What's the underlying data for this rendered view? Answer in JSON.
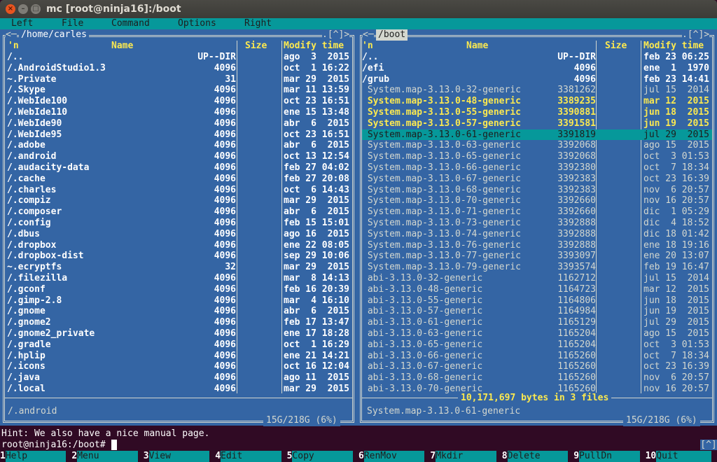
{
  "window": {
    "title": "mc [root@ninja16]:/boot",
    "buttons": [
      "close",
      "minimize",
      "maximize"
    ]
  },
  "menubar": [
    "Left",
    "File",
    "Command",
    "Options",
    "Right"
  ],
  "left_panel": {
    "path": "/home/carles",
    "nav_left": "<─",
    "corner": ".[^]>",
    "columns": {
      "sort": "'n",
      "name": "Name",
      "size": "Size",
      "mtime": "Modify time"
    },
    "rows": [
      {
        "name": "/..",
        "size": "UP--DIR",
        "mtime": "ago  3  2015",
        "type": "dir"
      },
      {
        "name": "/.AndroidStudio1.3",
        "size": "4096",
        "mtime": "oct  1 16:22",
        "type": "dir"
      },
      {
        "name": "~.Private",
        "size": "31",
        "mtime": "mar 29  2015",
        "type": "dir"
      },
      {
        "name": "/.Skype",
        "size": "4096",
        "mtime": "mar 11 13:59",
        "type": "dir"
      },
      {
        "name": "/.WebIde100",
        "size": "4096",
        "mtime": "oct 23 16:51",
        "type": "dir"
      },
      {
        "name": "/.WebIde110",
        "size": "4096",
        "mtime": "ene 15 13:48",
        "type": "dir"
      },
      {
        "name": "/.WebIde90",
        "size": "4096",
        "mtime": "abr  6  2015",
        "type": "dir"
      },
      {
        "name": "/.WebIde95",
        "size": "4096",
        "mtime": "oct 23 16:51",
        "type": "dir"
      },
      {
        "name": "/.adobe",
        "size": "4096",
        "mtime": "abr  6  2015",
        "type": "dir"
      },
      {
        "name": "/.android",
        "size": "4096",
        "mtime": "oct 13 12:54",
        "type": "dir"
      },
      {
        "name": "/.audacity-data",
        "size": "4096",
        "mtime": "feb 27 04:02",
        "type": "dir"
      },
      {
        "name": "/.cache",
        "size": "4096",
        "mtime": "feb 27 20:08",
        "type": "dir"
      },
      {
        "name": "/.charles",
        "size": "4096",
        "mtime": "oct  6 14:43",
        "type": "dir"
      },
      {
        "name": "/.compiz",
        "size": "4096",
        "mtime": "mar 29  2015",
        "type": "dir"
      },
      {
        "name": "/.composer",
        "size": "4096",
        "mtime": "abr  6  2015",
        "type": "dir"
      },
      {
        "name": "/.config",
        "size": "4096",
        "mtime": "feb 15 15:01",
        "type": "dir"
      },
      {
        "name": "/.dbus",
        "size": "4096",
        "mtime": "ago 16  2015",
        "type": "dir"
      },
      {
        "name": "/.dropbox",
        "size": "4096",
        "mtime": "ene 22 08:05",
        "type": "dir"
      },
      {
        "name": "/.dropbox-dist",
        "size": "4096",
        "mtime": "sep 29 10:06",
        "type": "dir"
      },
      {
        "name": "~.ecryptfs",
        "size": "32",
        "mtime": "mar 29  2015",
        "type": "dir"
      },
      {
        "name": "/.filezilla",
        "size": "4096",
        "mtime": "mar  8 14:13",
        "type": "dir"
      },
      {
        "name": "/.gconf",
        "size": "4096",
        "mtime": "feb 16 20:39",
        "type": "dir"
      },
      {
        "name": "/.gimp-2.8",
        "size": "4096",
        "mtime": "mar  4 16:10",
        "type": "dir"
      },
      {
        "name": "/.gnome",
        "size": "4096",
        "mtime": "abr  6  2015",
        "type": "dir"
      },
      {
        "name": "/.gnome2",
        "size": "4096",
        "mtime": "feb 17 13:47",
        "type": "dir"
      },
      {
        "name": "/.gnome2_private",
        "size": "4096",
        "mtime": "ene 17 18:28",
        "type": "dir"
      },
      {
        "name": "/.gradle",
        "size": "4096",
        "mtime": "oct  1 16:29",
        "type": "dir"
      },
      {
        "name": "/.hplip",
        "size": "4096",
        "mtime": "ene 21 14:21",
        "type": "dir"
      },
      {
        "name": "/.icons",
        "size": "4096",
        "mtime": "oct 16 12:04",
        "type": "dir"
      },
      {
        "name": "/.java",
        "size": "4096",
        "mtime": "ago 11  2015",
        "type": "dir"
      },
      {
        "name": "/.local",
        "size": "4096",
        "mtime": "mar 29  2015",
        "type": "dir"
      }
    ],
    "mini_status": "/.android",
    "disk_info": "15G/218G (6%)"
  },
  "right_panel": {
    "path": "/boot",
    "nav_left": "<─",
    "corner": ".[^]>",
    "columns": {
      "sort": "'n",
      "name": "Name",
      "size": "Size",
      "mtime": "Modify time"
    },
    "rows": [
      {
        "name": "/..",
        "size": "UP--DIR",
        "mtime": "feb 23 06:25",
        "type": "dir"
      },
      {
        "name": "/efi",
        "size": "4096",
        "mtime": "ene  1  1970",
        "type": "dir"
      },
      {
        "name": "/grub",
        "size": "4096",
        "mtime": "feb 23 14:41",
        "type": "dir"
      },
      {
        "name": " System.map-3.13.0-32-generic",
        "size": "3381262",
        "mtime": "jul 15  2014",
        "type": "file"
      },
      {
        "name": " System.map-3.13.0-48-generic",
        "size": "3389235",
        "mtime": "mar 12  2015",
        "type": "marked"
      },
      {
        "name": " System.map-3.13.0-55-generic",
        "size": "3390881",
        "mtime": "jun 18  2015",
        "type": "marked"
      },
      {
        "name": " System.map-3.13.0-57-generic",
        "size": "3391581",
        "mtime": "jun 19  2015",
        "type": "marked"
      },
      {
        "name": " System.map-3.13.0-61-generic",
        "size": "3391819",
        "mtime": "jul 29  2015",
        "type": "selected"
      },
      {
        "name": " System.map-3.13.0-63-generic",
        "size": "3392068",
        "mtime": "ago 15  2015",
        "type": "file"
      },
      {
        "name": " System.map-3.13.0-65-generic",
        "size": "3392068",
        "mtime": "oct  3 01:53",
        "type": "file"
      },
      {
        "name": " System.map-3.13.0-66-generic",
        "size": "3392380",
        "mtime": "oct  7 18:34",
        "type": "file"
      },
      {
        "name": " System.map-3.13.0-67-generic",
        "size": "3392383",
        "mtime": "oct 23 16:39",
        "type": "file"
      },
      {
        "name": " System.map-3.13.0-68-generic",
        "size": "3392383",
        "mtime": "nov  6 20:57",
        "type": "file"
      },
      {
        "name": " System.map-3.13.0-70-generic",
        "size": "3392660",
        "mtime": "nov 16 20:57",
        "type": "file"
      },
      {
        "name": " System.map-3.13.0-71-generic",
        "size": "3392660",
        "mtime": "dic  1 05:29",
        "type": "file"
      },
      {
        "name": " System.map-3.13.0-73-generic",
        "size": "3392888",
        "mtime": "dic  4 18:52",
        "type": "file"
      },
      {
        "name": " System.map-3.13.0-74-generic",
        "size": "3392888",
        "mtime": "dic 18 01:42",
        "type": "file"
      },
      {
        "name": " System.map-3.13.0-76-generic",
        "size": "3392888",
        "mtime": "ene 18 19:16",
        "type": "file"
      },
      {
        "name": " System.map-3.13.0-77-generic",
        "size": "3393097",
        "mtime": "ene 20 13:07",
        "type": "file"
      },
      {
        "name": " System.map-3.13.0-79-generic",
        "size": "3393574",
        "mtime": "feb 19 16:47",
        "type": "file"
      },
      {
        "name": " abi-3.13.0-32-generic",
        "size": "1162712",
        "mtime": "jul 15  2014",
        "type": "file"
      },
      {
        "name": " abi-3.13.0-48-generic",
        "size": "1164723",
        "mtime": "mar 12  2015",
        "type": "file"
      },
      {
        "name": " abi-3.13.0-55-generic",
        "size": "1164806",
        "mtime": "jun 18  2015",
        "type": "file"
      },
      {
        "name": " abi-3.13.0-57-generic",
        "size": "1164984",
        "mtime": "jun 19  2015",
        "type": "file"
      },
      {
        "name": " abi-3.13.0-61-generic",
        "size": "1165129",
        "mtime": "jul 29  2015",
        "type": "file"
      },
      {
        "name": " abi-3.13.0-63-generic",
        "size": "1165204",
        "mtime": "ago 15  2015",
        "type": "file"
      },
      {
        "name": " abi-3.13.0-65-generic",
        "size": "1165204",
        "mtime": "oct  3 01:53",
        "type": "file"
      },
      {
        "name": " abi-3.13.0-66-generic",
        "size": "1165260",
        "mtime": "oct  7 18:34",
        "type": "file"
      },
      {
        "name": " abi-3.13.0-67-generic",
        "size": "1165260",
        "mtime": "oct 23 16:39",
        "type": "file"
      },
      {
        "name": " abi-3.13.0-68-generic",
        "size": "1165260",
        "mtime": "nov  6 20:57",
        "type": "file"
      },
      {
        "name": " abi-3.13.0-70-generic",
        "size": "1165260",
        "mtime": "nov 16 20:57",
        "type": "file"
      }
    ],
    "selection_summary": "10,171,697 bytes in 3 files",
    "mini_status": "System.map-3.13.0-61-generic",
    "disk_info": "15G/218G (6%)"
  },
  "hint": "Hint: We also have a nice manual page.",
  "prompt": "root@ninja16:/boot#",
  "command_input": "",
  "caret_button": "[^]",
  "fkeys": [
    {
      "num": "1",
      "label": "Help"
    },
    {
      "num": "2",
      "label": "Menu"
    },
    {
      "num": "3",
      "label": "View"
    },
    {
      "num": "4",
      "label": "Edit"
    },
    {
      "num": "5",
      "label": "Copy"
    },
    {
      "num": "6",
      "label": "RenMov"
    },
    {
      "num": "7",
      "label": "Mkdir"
    },
    {
      "num": "8",
      "label": "Delete"
    },
    {
      "num": "9",
      "label": "PullDn"
    },
    {
      "num": "10",
      "label": "Quit"
    }
  ],
  "colors": {
    "panel_bg": "#3465a4",
    "menubar_bg": "#06989a",
    "selection_bg": "#06989a",
    "marked_fg": "#fce94f",
    "terminal_bg": "#300a24"
  }
}
